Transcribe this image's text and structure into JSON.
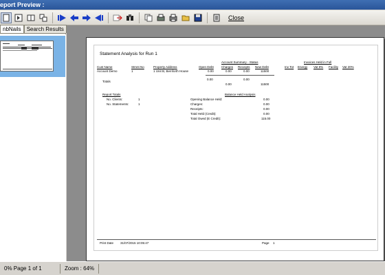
{
  "window": {
    "title": "eport Preview :"
  },
  "toolbar": {
    "close_label": "Close"
  },
  "tabs": [
    {
      "label": "nbNails"
    },
    {
      "label": "Search Results"
    }
  ],
  "report": {
    "title": "Statement Analysis for Run 1",
    "group_headers": {
      "account_summary": "Account Summary - Status",
      "invoices_held": "Invoices Held in Full"
    },
    "columns": [
      "Cust Name",
      "Stmnt No",
      "Property Address",
      "Open Debt",
      "Charges",
      "Receipts",
      "New Debt",
      "Inv Tot",
      "Energy",
      "Vat 8%",
      "Facility",
      "Vat 20%"
    ],
    "row": {
      "cust": "Account Demo",
      "stmnt": "1",
      "address": "1 Unit B, Bemforth House",
      "open": "0.00",
      "charges": "0.00",
      "receipts": "0.00",
      "new": "11500"
    },
    "totals_label": "Totals",
    "totals": {
      "open": "0.00",
      "charges": "0.00",
      "receipts": "0.00",
      "new": "11500"
    },
    "report_totals": {
      "title": "Report Totals",
      "clients_label": "No. Clients:",
      "clients": "1",
      "statements_label": "No. Statements:",
      "statements": "1"
    },
    "balance": {
      "title": "Balance Held Analysis",
      "items": [
        {
          "label": "Opening Balance Held:",
          "value": "0.00"
        },
        {
          "label": "Charges:",
          "value": "0.00"
        },
        {
          "label": "Receipts:",
          "value": "0.00"
        },
        {
          "label": "Total Held (Credit):",
          "value": "0.00"
        },
        {
          "label": "Total Owed (E Credit):",
          "value": "115.00"
        }
      ]
    },
    "footer": {
      "print_date_label": "Print Date",
      "print_date": "31/07/2015 10:05:47",
      "page_label": "Page",
      "page": "1"
    }
  },
  "status": {
    "progress": "0% Page 1 of 1",
    "zoom": "Zoom : 64%"
  }
}
